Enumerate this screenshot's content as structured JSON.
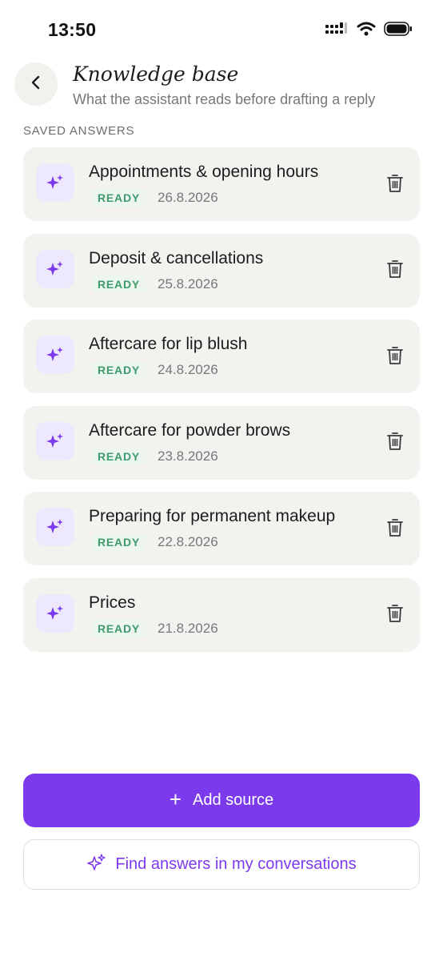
{
  "status_bar": {
    "time": "13:50",
    "icons": [
      "signal-icon",
      "wifi-icon",
      "battery-icon"
    ]
  },
  "header": {
    "back_icon": "chevron-left-icon",
    "title": "Knowledge base",
    "subtitle": "What the assistant reads before drafting a reply"
  },
  "section": {
    "label": "SAVED ANSWERS"
  },
  "answers": [
    {
      "title": "Appointments & opening hours",
      "status": "READY",
      "date": "26.8.2026"
    },
    {
      "title": "Deposit & cancellations",
      "status": "READY",
      "date": "25.8.2026"
    },
    {
      "title": "Aftercare for lip blush",
      "status": "READY",
      "date": "24.8.2026"
    },
    {
      "title": "Aftercare for powder brows",
      "status": "READY",
      "date": "23.8.2026"
    },
    {
      "title": "Preparing for permanent makeup",
      "status": "READY",
      "date": "22.8.2026"
    },
    {
      "title": "Prices",
      "status": "READY",
      "date": "21.8.2026"
    }
  ],
  "actions": {
    "add_source_label": "Add source",
    "find_answers_label": "Find answers in my conversations"
  },
  "colors": {
    "accent": "#7c3aed",
    "ready_text": "#3f9a6c",
    "card_bg": "#f3f2ef",
    "icon_bg": "#ede8fb"
  }
}
